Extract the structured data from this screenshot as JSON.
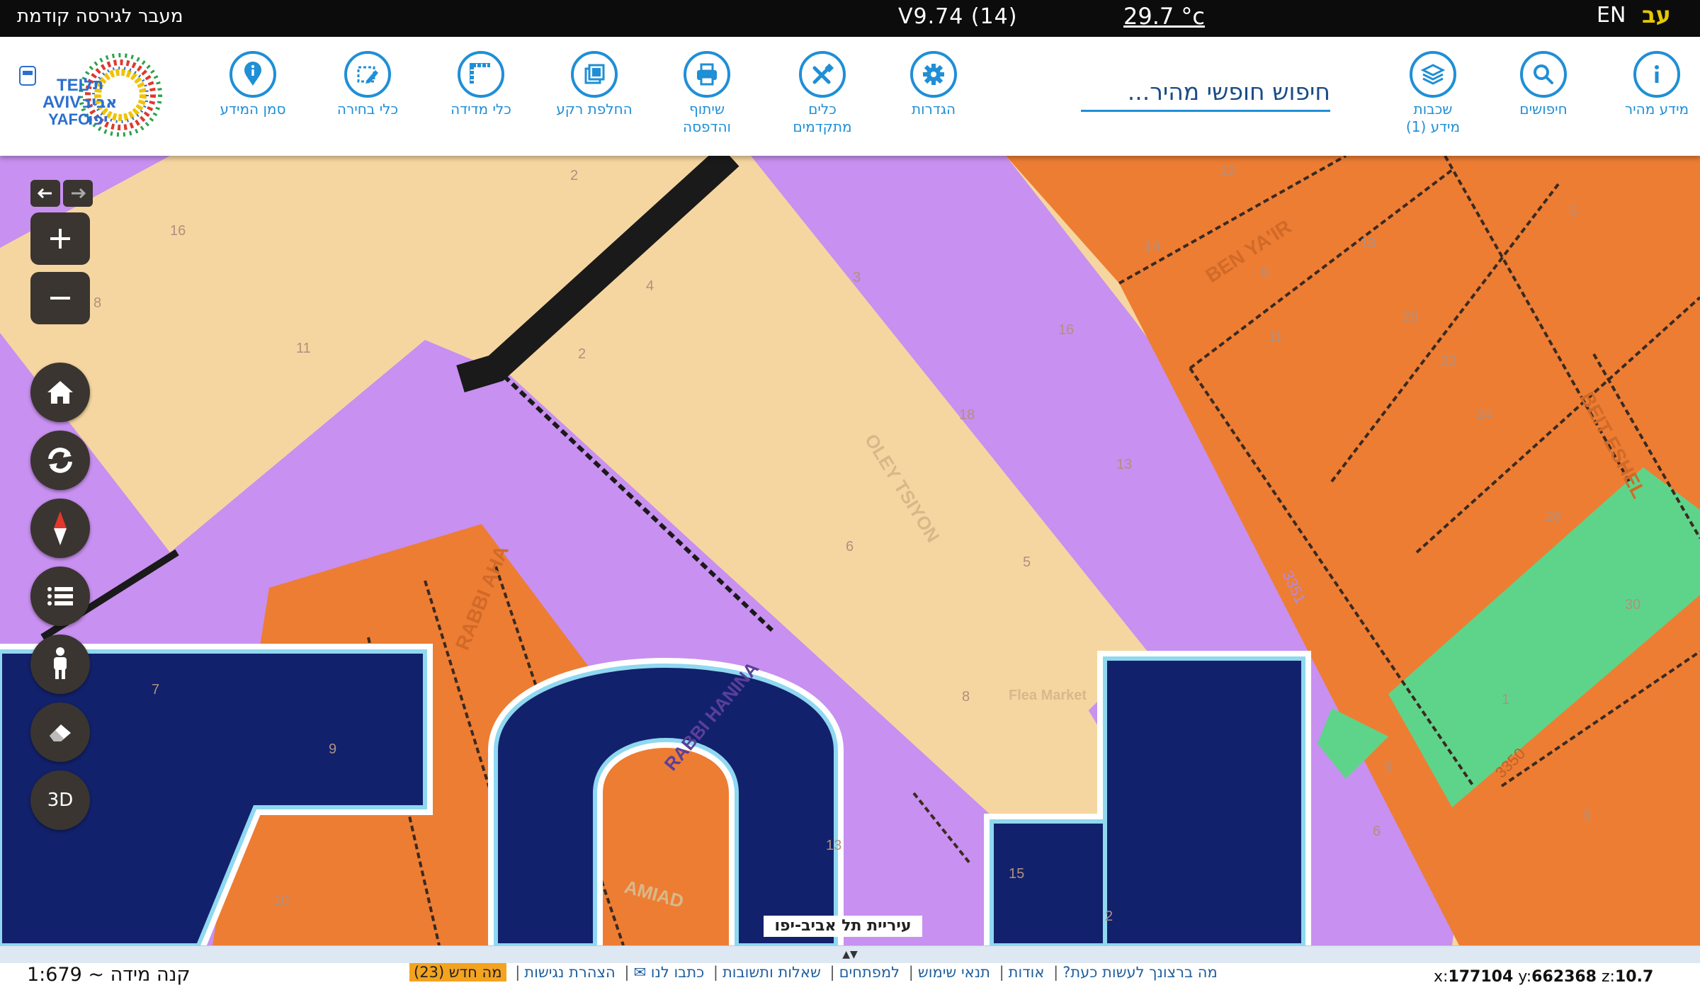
{
  "topbar": {
    "prev_version": "מעבר לגירסה קודמת",
    "version": "V9.74 (14)",
    "temperature": "29.7 °c",
    "lang_en": "EN",
    "lang_he": "עב"
  },
  "toolbar": {
    "search_placeholder": "חיפוש חופשי מהיר...",
    "tools": [
      {
        "id": "quick-info",
        "label": "מידע מהיר",
        "icon": "info-icon"
      },
      {
        "id": "searches",
        "label": "חיפושים",
        "icon": "search-icon"
      },
      {
        "id": "layers",
        "label": "שכבות מידע (1)",
        "icon": "layers-icon"
      },
      {
        "id": "settings",
        "label": "הגדרות",
        "icon": "gear-icon"
      },
      {
        "id": "advanced-tools",
        "label": "כלים מתקדמים",
        "icon": "tools-icon"
      },
      {
        "id": "share-print",
        "label": "שיתוף והדפסה",
        "icon": "print-icon"
      },
      {
        "id": "basemap",
        "label": "החלפת רקע",
        "icon": "basemap-icon"
      },
      {
        "id": "measure",
        "label": "כלי מדידה",
        "icon": "ruler-icon"
      },
      {
        "id": "select",
        "label": "כלי בחירה",
        "icon": "select-icon"
      },
      {
        "id": "identify",
        "label": "סמן המידע",
        "icon": "pin-info-icon"
      }
    ],
    "logo": {
      "text_en_1": "TEL",
      "text_en_2": "AVIV",
      "text_en_3": "YAFO",
      "text_he_1": "תל",
      "text_he_2": "אביב",
      "text_he_3": "יפו"
    }
  },
  "map": {
    "labels": [
      "BEN YA'IR",
      "BEIT ESHEL",
      "OLEY TSIYON",
      "RABBI AHA",
      "RABBI HANINA",
      "AMIAD",
      "Flea Market",
      "3351",
      "3350"
    ],
    "numbers": [
      "2",
      "4",
      "3",
      "16",
      "8",
      "11",
      "2",
      "12",
      "14",
      "18",
      "9",
      "20",
      "22",
      "11",
      "24",
      "16",
      "18",
      "13",
      "5",
      "6",
      "5",
      "3",
      "26",
      "1",
      "30",
      "8",
      "13",
      "15",
      "10",
      "9",
      "7",
      "6",
      "3",
      "2"
    ],
    "attribution": "עיריית תל אביב-יפו"
  },
  "controls": {
    "threed": "3D"
  },
  "bottombar": {
    "scale": "קנה מידה ~ 1:679",
    "links": [
      "מה ברצונך לעשות כעת?",
      "אודות",
      "תנאי שימוש",
      "למפתחים",
      "שאלות ותשובות",
      "כתבו לנו ✉",
      "הצהרת נגישות"
    ],
    "new_label": "מה חדש (23)",
    "coord_x_label": "x:",
    "coord_x": "177104",
    "coord_y_label": "y:",
    "coord_y": "662368",
    "coord_z_label": "z:",
    "coord_z": "10.7"
  },
  "colors": {
    "accent": "#1f8fd6",
    "landuse_residential": "#f6d6a0",
    "landuse_road": "#c890f0",
    "landuse_commercial": "#ed7d33",
    "landuse_park": "#5ed48a",
    "overlay_navy": "#12216b"
  }
}
